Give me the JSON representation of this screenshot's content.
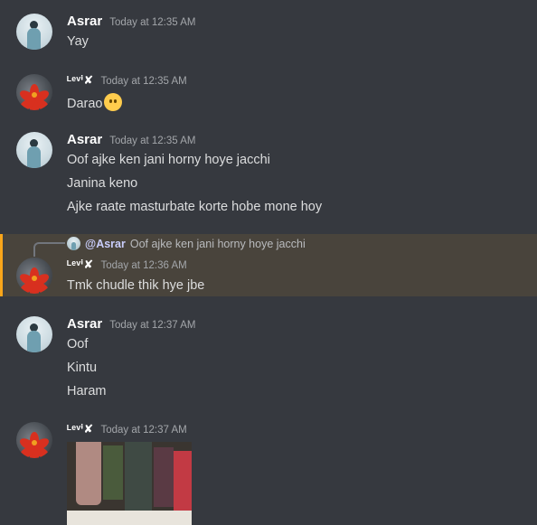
{
  "messages": [
    {
      "author": "Asrar",
      "time": "Today at 12:35 AM",
      "lines": [
        "Yay"
      ]
    },
    {
      "author": "ᴸᵉᵛⁱ✘",
      "time": "Today at 12:35 AM",
      "lines": [
        "Darao"
      ],
      "emoji": "no-mouth-face-icon"
    },
    {
      "author": "Asrar",
      "time": "Today at 12:35 AM",
      "lines": [
        "Oof ajke ken jani horny hoye jacchi",
        "Janina keno",
        "Ajke raate masturbate korte hobe mone hoy"
      ]
    },
    {
      "author": "ᴸᵉᵛⁱ✘",
      "time": "Today at 12:36 AM",
      "reply_to": {
        "mention": "@Asrar",
        "text": "Oof ajke ken jani horny hoye jacchi"
      },
      "lines": [
        "Tmk chudle thik hye jbe"
      ]
    },
    {
      "author": "Asrar",
      "time": "Today at 12:37 AM",
      "lines": [
        "Oof",
        "Kintu",
        "Haram"
      ]
    },
    {
      "author": "ᴸᵉᵛⁱ✘",
      "time": "Today at 12:37 AM",
      "attachment": "image-attachment"
    }
  ],
  "colors": {
    "background": "#36393f",
    "highlight": "#49443c",
    "accent": "#faa61a",
    "mention": "#c9cdfb"
  }
}
